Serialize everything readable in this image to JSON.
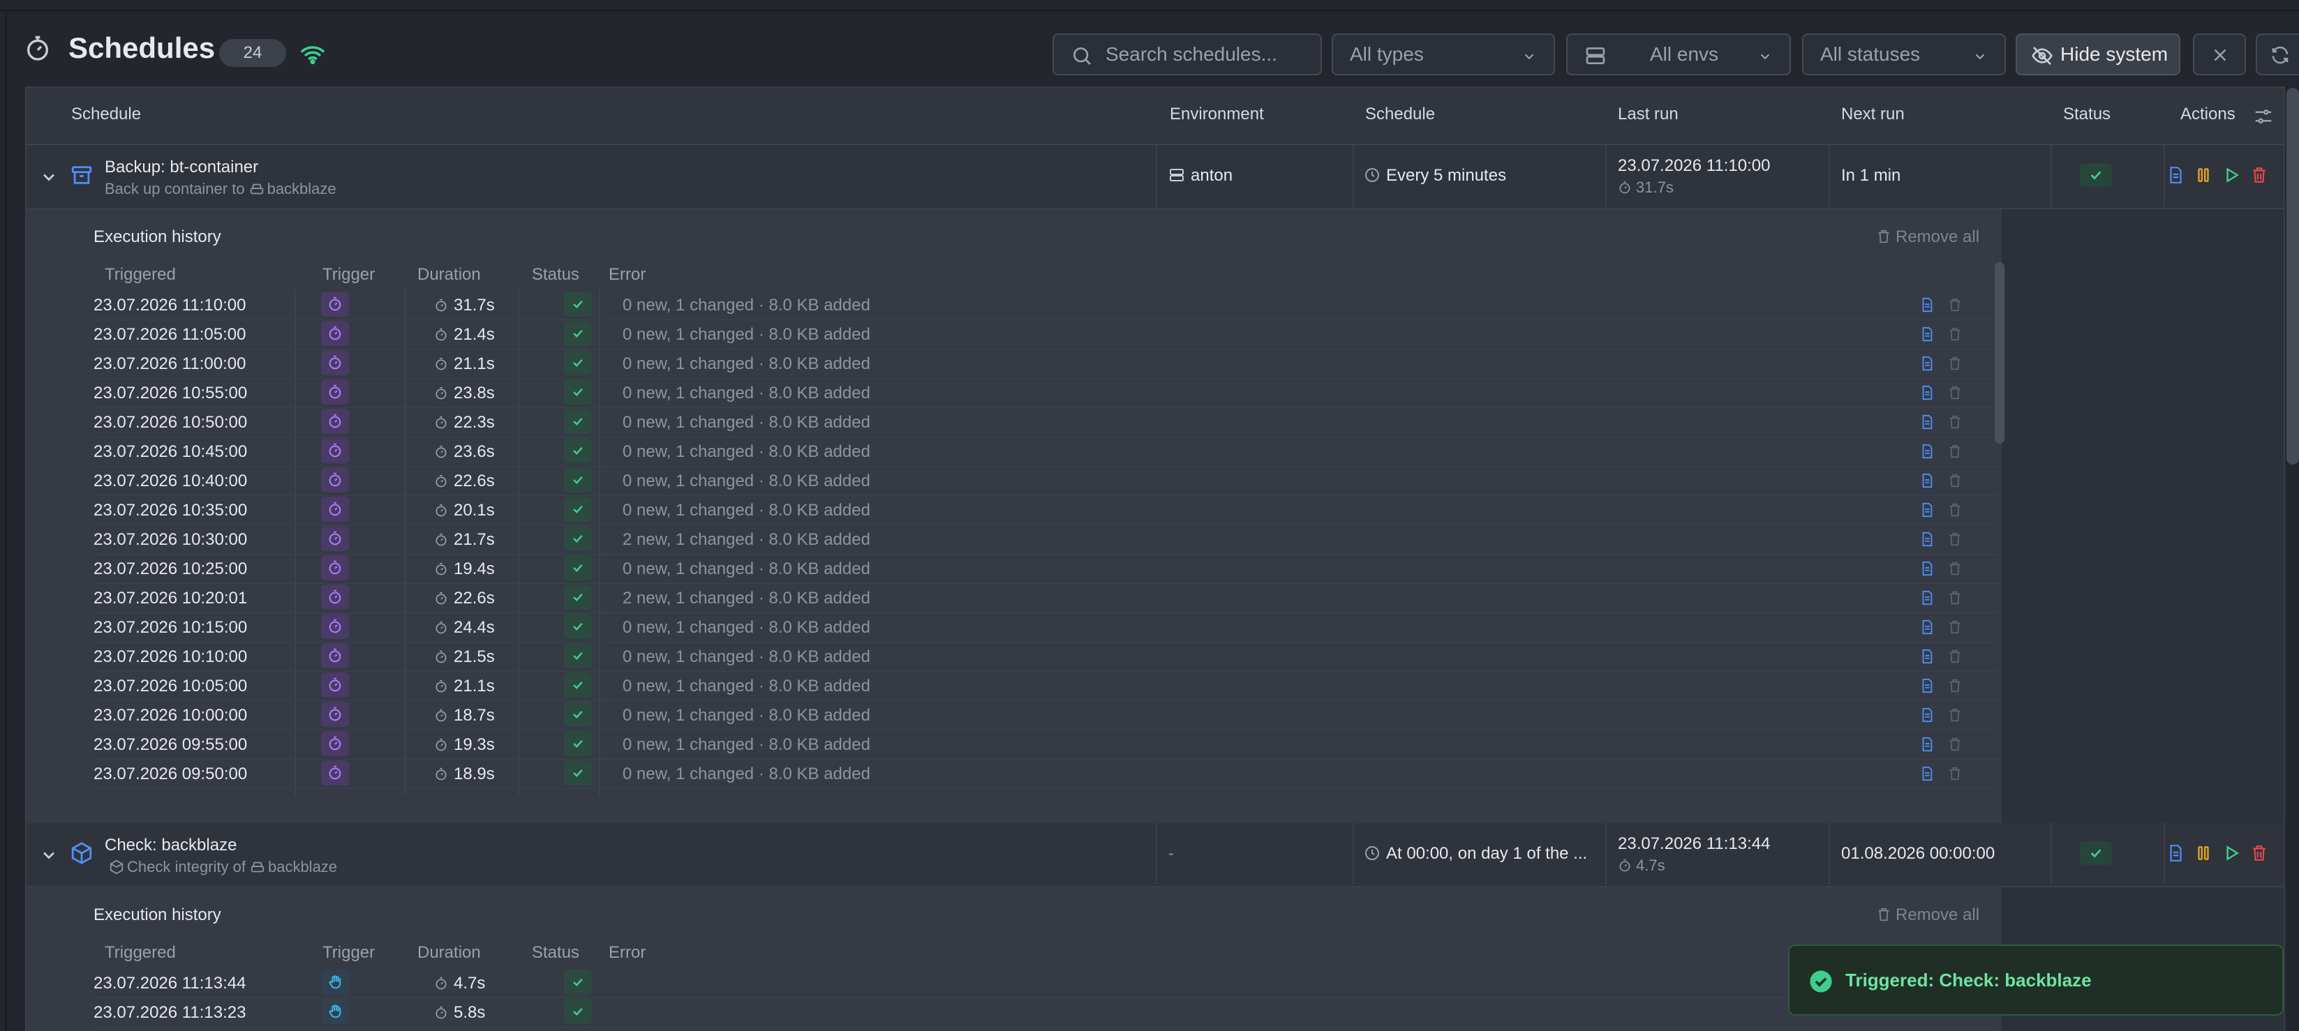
{
  "header": {
    "title": "Schedules",
    "count": "24",
    "search_placeholder": "Search schedules...",
    "types_label": "All types",
    "envs_label": "All envs",
    "statuses_label": "All statuses",
    "hide_system_label": "Hide system"
  },
  "table": {
    "columns": [
      "Schedule",
      "Environment",
      "Schedule",
      "Last run",
      "Next run",
      "Status",
      "Actions"
    ]
  },
  "schedules": [
    {
      "title": "Backup: bt-container",
      "subtitle_prefix": "Back up container to",
      "subtitle_target": "backblaze",
      "environment": "anton",
      "schedule": "Every 5 minutes",
      "last_run": "23.07.2026 11:10:00",
      "last_duration": "31.7s",
      "next_run": "In 1 min",
      "status": "ok"
    },
    {
      "title": "Check: backblaze",
      "subtitle_prefix": "Check integrity of",
      "subtitle_target": "backblaze",
      "environment": "-",
      "schedule": "At 00:00, on day 1 of the ...",
      "last_run": "23.07.2026 11:13:44",
      "last_duration": "4.7s",
      "next_run": "01.08.2026 00:00:00",
      "status": "ok"
    }
  ],
  "history": {
    "title": "Execution history",
    "remove_all": "Remove all",
    "columns": [
      "Triggered",
      "Trigger",
      "Duration",
      "Status",
      "Error"
    ],
    "backup_rows": [
      {
        "t": "23.07.2026 11:10:00",
        "d": "31.7s",
        "e": "0 new, 1 changed · 8.0 KB added"
      },
      {
        "t": "23.07.2026 11:05:00",
        "d": "21.4s",
        "e": "0 new, 1 changed · 8.0 KB added"
      },
      {
        "t": "23.07.2026 11:00:00",
        "d": "21.1s",
        "e": "0 new, 1 changed · 8.0 KB added"
      },
      {
        "t": "23.07.2026 10:55:00",
        "d": "23.8s",
        "e": "0 new, 1 changed · 8.0 KB added"
      },
      {
        "t": "23.07.2026 10:50:00",
        "d": "22.3s",
        "e": "0 new, 1 changed · 8.0 KB added"
      },
      {
        "t": "23.07.2026 10:45:00",
        "d": "23.6s",
        "e": "0 new, 1 changed · 8.0 KB added"
      },
      {
        "t": "23.07.2026 10:40:00",
        "d": "22.6s",
        "e": "0 new, 1 changed · 8.0 KB added"
      },
      {
        "t": "23.07.2026 10:35:00",
        "d": "20.1s",
        "e": "0 new, 1 changed · 8.0 KB added"
      },
      {
        "t": "23.07.2026 10:30:00",
        "d": "21.7s",
        "e": "2 new, 1 changed · 8.0 KB added"
      },
      {
        "t": "23.07.2026 10:25:00",
        "d": "19.4s",
        "e": "0 new, 1 changed · 8.0 KB added"
      },
      {
        "t": "23.07.2026 10:20:01",
        "d": "22.6s",
        "e": "2 new, 1 changed · 8.0 KB added"
      },
      {
        "t": "23.07.2026 10:15:00",
        "d": "24.4s",
        "e": "0 new, 1 changed · 8.0 KB added"
      },
      {
        "t": "23.07.2026 10:10:00",
        "d": "21.5s",
        "e": "0 new, 1 changed · 8.0 KB added"
      },
      {
        "t": "23.07.2026 10:05:00",
        "d": "21.1s",
        "e": "0 new, 1 changed · 8.0 KB added"
      },
      {
        "t": "23.07.2026 10:00:00",
        "d": "18.7s",
        "e": "0 new, 1 changed · 8.0 KB added"
      },
      {
        "t": "23.07.2026 09:55:00",
        "d": "19.3s",
        "e": "0 new, 1 changed · 8.0 KB added"
      },
      {
        "t": "23.07.2026 09:50:00",
        "d": "18.9s",
        "e": "0 new, 1 changed · 8.0 KB added"
      }
    ],
    "check_rows": [
      {
        "t": "23.07.2026 11:13:44",
        "d": "4.7s",
        "e": ""
      },
      {
        "t": "23.07.2026 11:13:23",
        "d": "5.8s",
        "e": ""
      }
    ]
  },
  "toast": {
    "message": "Triggered: Check: backblaze"
  },
  "colors": {
    "accent_green": "#3ecf8e",
    "trigger_purple": "#a77bf3",
    "trigger_manual": "#38b6e8",
    "doc_blue": "#4f8ff7",
    "pause_amber": "#e0a526",
    "play_green": "#3ecf8e",
    "delete_red": "#e5484d"
  }
}
